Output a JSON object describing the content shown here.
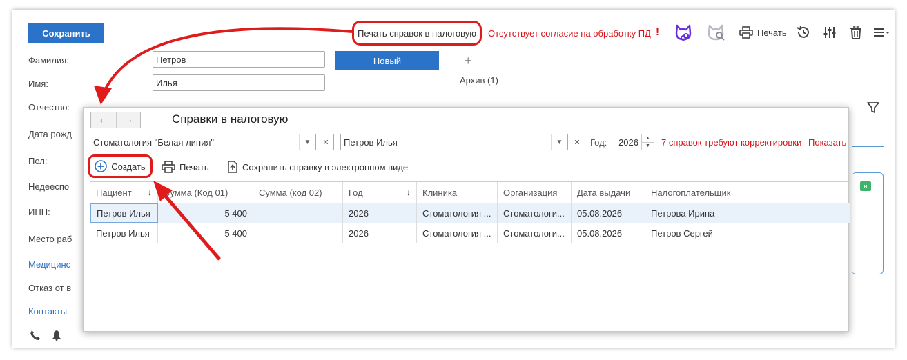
{
  "toolbar": {
    "save_label": "Сохранить",
    "print_tax_label": "Печать справок в налоговую",
    "no_consent_text": "Отсутствует согласие на обработку ПД",
    "exclaim": "!",
    "print_label": "Печать"
  },
  "form": {
    "surname_label": "Фамилия:",
    "surname_value": "Петров",
    "name_label": "Имя:",
    "name_value": "Илья",
    "patronymic_label": "Отчество:",
    "birth_label": "Дата рожд",
    "sex_label": "Пол:",
    "incapable_label": "Недееспо",
    "inn_label": "ИНН:",
    "workplace_label": "Место раб",
    "medical_link": "Медицинс",
    "refusal_label": "Отказ от в",
    "contacts_link": "Контакты",
    "new_button": "Новый",
    "plus": "+",
    "archive": "Архив (1)",
    "badge": "н"
  },
  "dialog": {
    "title": "Справки в налоговую",
    "clinic_value": "Стоматология \"Белая линия\"",
    "patient_value": "Петров Илья",
    "year_label": "Год:",
    "year_value": "2026",
    "need_fix_text": "7 справок требуют корректировки",
    "show_link": "Показать",
    "create_label": "Создать",
    "print_label": "Печать",
    "save_electronic_label": "Сохранить справку в электронном виде",
    "columns": [
      "Пациент",
      "Сумма (Код 01)",
      "Сумма (код 02)",
      "Год",
      "Клиника",
      "Организация",
      "Дата выдачи",
      "Налогоплательщик"
    ],
    "rows": [
      [
        "Петров Илья",
        "5 400",
        "",
        "2026",
        "Стоматология ...",
        "Стоматологи...",
        "05.08.2026",
        "Петрова Ирина"
      ],
      [
        "Петров Илья",
        "5 400",
        "",
        "2026",
        "Стоматология ...",
        "Стоматологи...",
        "05.08.2026",
        "Петров Сергей"
      ]
    ]
  },
  "colors": {
    "accent": "#2a73c9",
    "annotation_red": "#e01b1b",
    "warning_red": "#d8141a"
  }
}
